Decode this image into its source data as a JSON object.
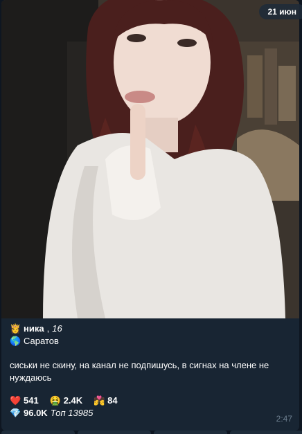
{
  "date_label": "21 июн",
  "post": {
    "photo_alt": "",
    "profile": {
      "avatar_emoji": "👸",
      "name": "ника",
      "age_sep": ",",
      "age": "16",
      "location_emoji": "🌎",
      "city": "Саратов"
    },
    "text": "сиськи не скину, на канал не подпишусь, в сигнах на члене не нуждаюсь",
    "stats": {
      "hearts_emoji": "❤️",
      "hearts": "541",
      "sick_emoji": "🤮",
      "sick": "2.4K",
      "kiss_emoji": "💏",
      "kiss": "84",
      "diamond_emoji": "💎",
      "diamond": "96.0K",
      "top_label": "Топ 13985"
    },
    "time": "2:47"
  }
}
